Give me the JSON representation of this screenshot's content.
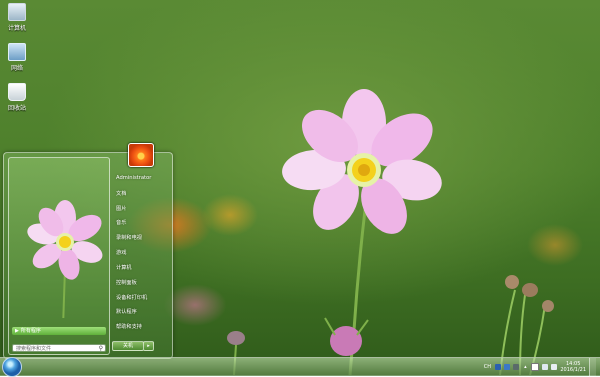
{
  "desktop": {
    "icons": [
      {
        "label": "计算机",
        "icon": "computer-icon"
      },
      {
        "label": "网络",
        "icon": "network-icon"
      },
      {
        "label": "回收站",
        "icon": "recycle-bin-icon"
      }
    ]
  },
  "start_menu": {
    "all_programs": "所有程序",
    "search_placeholder": "搜索程序和文件",
    "shutdown": "关机",
    "user_name": "Administrator",
    "items": [
      "文档",
      "图片",
      "音乐",
      "游戏",
      "计算机",
      "控制面板",
      "设备和打印机",
      "默认程序",
      "帮助和支持"
    ],
    "recent_item": "录制和电视"
  },
  "taskbar": {
    "language": "CH",
    "time": "14:05",
    "date": "2016/1/21"
  },
  "colors": {
    "accent": "#5fb03a",
    "wallpaper_green": "#4d7f2b",
    "flower_pink": "#e7a6dc"
  }
}
